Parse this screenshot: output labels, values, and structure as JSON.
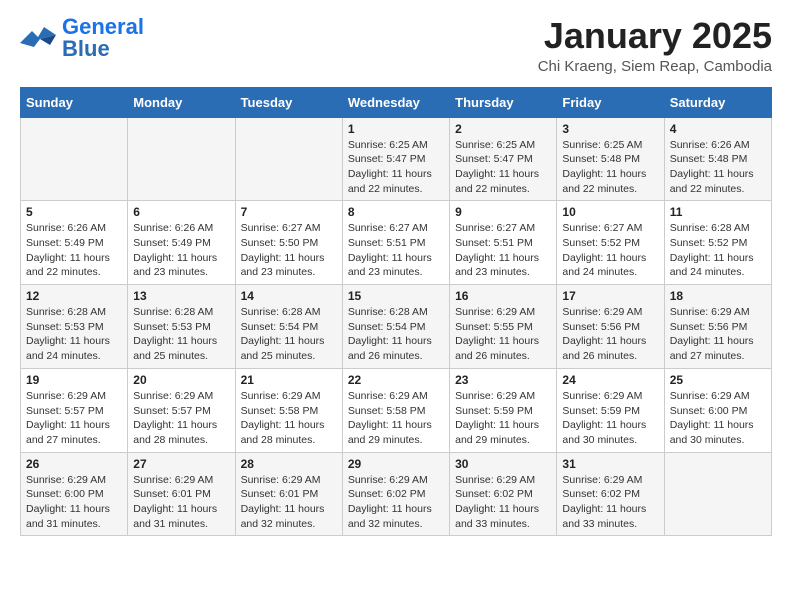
{
  "header": {
    "logo_general": "General",
    "logo_blue": "Blue",
    "main_title": "January 2025",
    "subtitle": "Chi Kraeng, Siem Reap, Cambodia"
  },
  "days_of_week": [
    "Sunday",
    "Monday",
    "Tuesday",
    "Wednesday",
    "Thursday",
    "Friday",
    "Saturday"
  ],
  "weeks": [
    [
      {
        "day": "",
        "info": ""
      },
      {
        "day": "",
        "info": ""
      },
      {
        "day": "",
        "info": ""
      },
      {
        "day": "1",
        "info": "Sunrise: 6:25 AM\nSunset: 5:47 PM\nDaylight: 11 hours and 22 minutes."
      },
      {
        "day": "2",
        "info": "Sunrise: 6:25 AM\nSunset: 5:47 PM\nDaylight: 11 hours and 22 minutes."
      },
      {
        "day": "3",
        "info": "Sunrise: 6:25 AM\nSunset: 5:48 PM\nDaylight: 11 hours and 22 minutes."
      },
      {
        "day": "4",
        "info": "Sunrise: 6:26 AM\nSunset: 5:48 PM\nDaylight: 11 hours and 22 minutes."
      }
    ],
    [
      {
        "day": "5",
        "info": "Sunrise: 6:26 AM\nSunset: 5:49 PM\nDaylight: 11 hours and 22 minutes."
      },
      {
        "day": "6",
        "info": "Sunrise: 6:26 AM\nSunset: 5:49 PM\nDaylight: 11 hours and 23 minutes."
      },
      {
        "day": "7",
        "info": "Sunrise: 6:27 AM\nSunset: 5:50 PM\nDaylight: 11 hours and 23 minutes."
      },
      {
        "day": "8",
        "info": "Sunrise: 6:27 AM\nSunset: 5:51 PM\nDaylight: 11 hours and 23 minutes."
      },
      {
        "day": "9",
        "info": "Sunrise: 6:27 AM\nSunset: 5:51 PM\nDaylight: 11 hours and 23 minutes."
      },
      {
        "day": "10",
        "info": "Sunrise: 6:27 AM\nSunset: 5:52 PM\nDaylight: 11 hours and 24 minutes."
      },
      {
        "day": "11",
        "info": "Sunrise: 6:28 AM\nSunset: 5:52 PM\nDaylight: 11 hours and 24 minutes."
      }
    ],
    [
      {
        "day": "12",
        "info": "Sunrise: 6:28 AM\nSunset: 5:53 PM\nDaylight: 11 hours and 24 minutes."
      },
      {
        "day": "13",
        "info": "Sunrise: 6:28 AM\nSunset: 5:53 PM\nDaylight: 11 hours and 25 minutes."
      },
      {
        "day": "14",
        "info": "Sunrise: 6:28 AM\nSunset: 5:54 PM\nDaylight: 11 hours and 25 minutes."
      },
      {
        "day": "15",
        "info": "Sunrise: 6:28 AM\nSunset: 5:54 PM\nDaylight: 11 hours and 26 minutes."
      },
      {
        "day": "16",
        "info": "Sunrise: 6:29 AM\nSunset: 5:55 PM\nDaylight: 11 hours and 26 minutes."
      },
      {
        "day": "17",
        "info": "Sunrise: 6:29 AM\nSunset: 5:56 PM\nDaylight: 11 hours and 26 minutes."
      },
      {
        "day": "18",
        "info": "Sunrise: 6:29 AM\nSunset: 5:56 PM\nDaylight: 11 hours and 27 minutes."
      }
    ],
    [
      {
        "day": "19",
        "info": "Sunrise: 6:29 AM\nSunset: 5:57 PM\nDaylight: 11 hours and 27 minutes."
      },
      {
        "day": "20",
        "info": "Sunrise: 6:29 AM\nSunset: 5:57 PM\nDaylight: 11 hours and 28 minutes."
      },
      {
        "day": "21",
        "info": "Sunrise: 6:29 AM\nSunset: 5:58 PM\nDaylight: 11 hours and 28 minutes."
      },
      {
        "day": "22",
        "info": "Sunrise: 6:29 AM\nSunset: 5:58 PM\nDaylight: 11 hours and 29 minutes."
      },
      {
        "day": "23",
        "info": "Sunrise: 6:29 AM\nSunset: 5:59 PM\nDaylight: 11 hours and 29 minutes."
      },
      {
        "day": "24",
        "info": "Sunrise: 6:29 AM\nSunset: 5:59 PM\nDaylight: 11 hours and 30 minutes."
      },
      {
        "day": "25",
        "info": "Sunrise: 6:29 AM\nSunset: 6:00 PM\nDaylight: 11 hours and 30 minutes."
      }
    ],
    [
      {
        "day": "26",
        "info": "Sunrise: 6:29 AM\nSunset: 6:00 PM\nDaylight: 11 hours and 31 minutes."
      },
      {
        "day": "27",
        "info": "Sunrise: 6:29 AM\nSunset: 6:01 PM\nDaylight: 11 hours and 31 minutes."
      },
      {
        "day": "28",
        "info": "Sunrise: 6:29 AM\nSunset: 6:01 PM\nDaylight: 11 hours and 32 minutes."
      },
      {
        "day": "29",
        "info": "Sunrise: 6:29 AM\nSunset: 6:02 PM\nDaylight: 11 hours and 32 minutes."
      },
      {
        "day": "30",
        "info": "Sunrise: 6:29 AM\nSunset: 6:02 PM\nDaylight: 11 hours and 33 minutes."
      },
      {
        "day": "31",
        "info": "Sunrise: 6:29 AM\nSunset: 6:02 PM\nDaylight: 11 hours and 33 minutes."
      },
      {
        "day": "",
        "info": ""
      }
    ]
  ]
}
